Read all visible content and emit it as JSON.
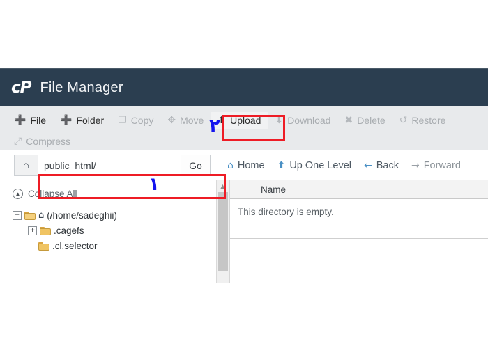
{
  "window": {
    "brand_logo": "cP",
    "title": "File Manager",
    "header_bg": "#2b3e50"
  },
  "toolbar": {
    "row1": [
      {
        "label": "File",
        "icon": "plus-icon",
        "glyph": "➕",
        "disabled": false
      },
      {
        "label": "Folder",
        "icon": "plus-icon",
        "glyph": "➕",
        "disabled": false
      },
      {
        "label": "Copy",
        "icon": "copy-icon",
        "glyph": "❐",
        "disabled": true
      },
      {
        "label": "Move",
        "icon": "move-icon",
        "glyph": "✥",
        "disabled": true
      },
      {
        "label": "Upload",
        "icon": "upload-icon",
        "glyph": "⬆",
        "disabled": false
      },
      {
        "label": "Download",
        "icon": "download-icon",
        "glyph": "⬇",
        "disabled": true
      },
      {
        "label": "Delete",
        "icon": "delete-icon",
        "glyph": "✖",
        "disabled": true
      },
      {
        "label": "Restore",
        "icon": "restore-icon",
        "glyph": "↺",
        "disabled": true
      }
    ],
    "row2": [
      {
        "label": "Compress",
        "icon": "compress-icon",
        "glyph": "⤢",
        "disabled": true
      }
    ]
  },
  "annotations": {
    "highlight_color": "#ee1c25",
    "pen_color": "#1414ee",
    "marks": [
      {
        "name": "step-2",
        "text": "٢",
        "target": "upload-button"
      },
      {
        "name": "step-1",
        "text": "١",
        "target": "path-input"
      }
    ],
    "boxes": [
      {
        "name": "upload-highlight",
        "target": "upload-button"
      },
      {
        "name": "path-highlight",
        "target": "path-input"
      }
    ]
  },
  "pathbar": {
    "home_icon": "home-icon",
    "home_glyph": "⌂",
    "value": "public_html/",
    "placeholder": "public_html/",
    "go_label": "Go",
    "nav": [
      {
        "label": "Home",
        "icon": "home-icon",
        "glyph": "⌂",
        "muted": false
      },
      {
        "label": "Up One Level",
        "icon": "arrow-up-icon",
        "glyph": "⬆",
        "muted": false
      },
      {
        "label": "Back",
        "icon": "arrow-left-icon",
        "glyph": "←",
        "muted": false
      },
      {
        "label": "Forward",
        "icon": "arrow-right-icon",
        "glyph": "→",
        "muted": true
      }
    ]
  },
  "tree": {
    "collapse_all_label": "Collapse All",
    "collapse_all_icon": "collapse-circle-icon",
    "nodes": [
      {
        "label": "(/home/sadeghii)",
        "expander": "−",
        "level": 1,
        "home": true,
        "open": true
      },
      {
        "label": ".cagefs",
        "expander": "+",
        "level": 2,
        "home": false,
        "open": false
      },
      {
        "label": ".cl.selector",
        "expander": "",
        "level": 2,
        "home": false,
        "open": false
      }
    ]
  },
  "filelist": {
    "columns": [
      "Name"
    ],
    "empty_message": "This directory is empty."
  }
}
